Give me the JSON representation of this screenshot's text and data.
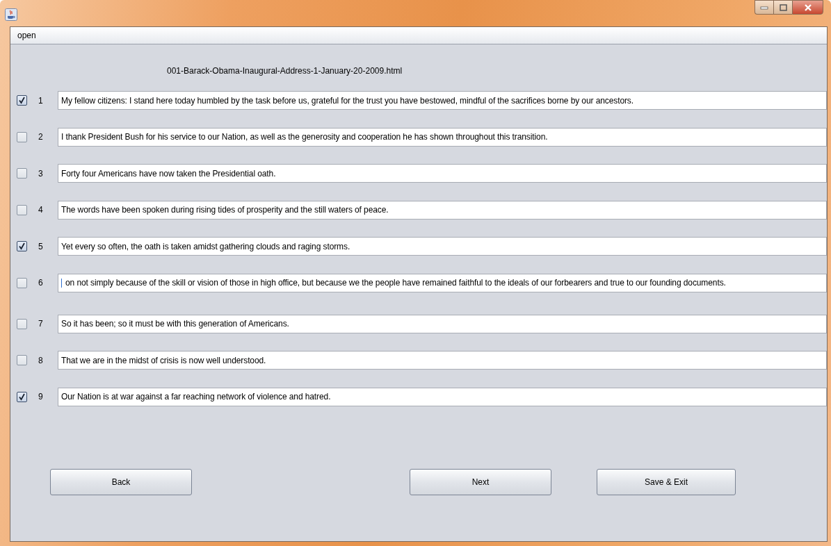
{
  "menu": [
    {
      "label": "open"
    }
  ],
  "file_name": "001-Barack-Obama-Inaugural-Address-1-January-20-2009.html",
  "rows": [
    {
      "number": "1",
      "checked": true,
      "text": "My fellow citizens:  I stand here today humbled by the task before us, grateful for the trust you have bestowed, mindful of the sacrifices borne by our ancestors.",
      "focused": false
    },
    {
      "number": "2",
      "checked": false,
      "text": "I thank President Bush for his service to our Nation, as well as the generosity and cooperation he has shown throughout this transition.",
      "focused": false
    },
    {
      "number": "3",
      "checked": false,
      "text": "Forty four Americans have now taken the Presidential oath.",
      "focused": false
    },
    {
      "number": "4",
      "checked": false,
      "text": "The words have been spoken during rising tides of prosperity and the still waters of peace.",
      "focused": false
    },
    {
      "number": "5",
      "checked": true,
      "text": "Yet every so often, the oath is taken amidst gathering clouds and raging storms.",
      "focused": false
    },
    {
      "number": "6",
      "checked": false,
      "text": "on not simply because of the skill or vision of those in high office, but because we the people have remained faithful to the ideals of our forbearers and true to our founding documents.",
      "focused": true
    },
    {
      "number": "7",
      "checked": false,
      "text": "So it has been; so it must be with this generation of Americans.",
      "focused": false
    },
    {
      "number": "8",
      "checked": false,
      "text": "That we are in the midst of crisis is now well understood.",
      "focused": false
    },
    {
      "number": "9",
      "checked": true,
      "text": "Our Nation is at war against a far reaching network of violence and hatred.",
      "focused": false
    }
  ],
  "buttons": [
    {
      "label": "Back"
    },
    {
      "label": "Next"
    },
    {
      "label": "Save & Exit"
    }
  ]
}
